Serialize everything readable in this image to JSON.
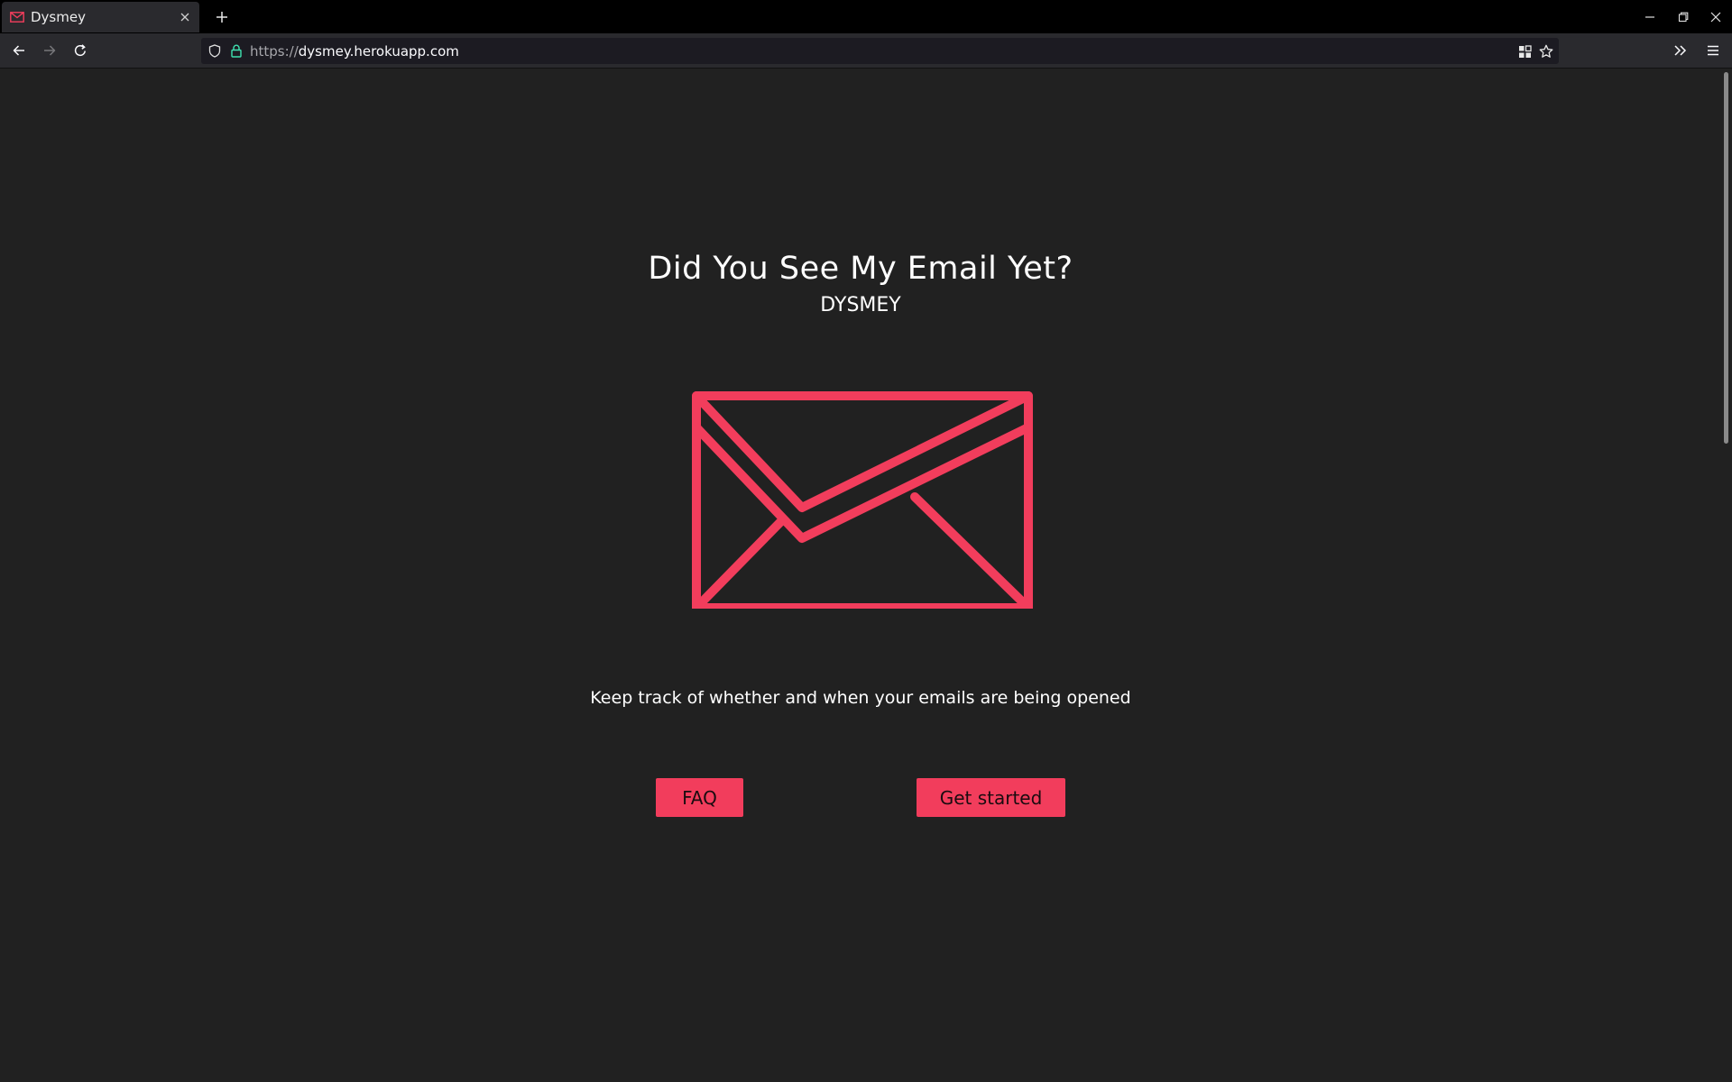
{
  "browser": {
    "tab": {
      "title": "Dysmey",
      "favicon": "envelope-icon"
    },
    "url": {
      "scheme": "https://",
      "host": "dysmey.herokuapp.com"
    },
    "icons": {
      "back": "arrow-left-icon",
      "forward": "arrow-right-icon",
      "reload": "reload-icon",
      "shield": "shield-icon",
      "lock": "lock-icon",
      "reader": "reader-view-icon",
      "bookmark": "star-icon",
      "overflow": "chevrons-right-icon",
      "menu": "hamburger-icon"
    }
  },
  "hero": {
    "title": "Did You See My Email Yet?",
    "subtitle": "DYSMEY",
    "logo_icon": "envelope-icon",
    "tagline": "Keep track of whether and when your emails are being opened"
  },
  "actions": {
    "faq_label": "FAQ",
    "start_label": "Get started"
  },
  "colors": {
    "accent": "#f23d5c",
    "page_background": "#212121",
    "text": "#ffffff"
  }
}
